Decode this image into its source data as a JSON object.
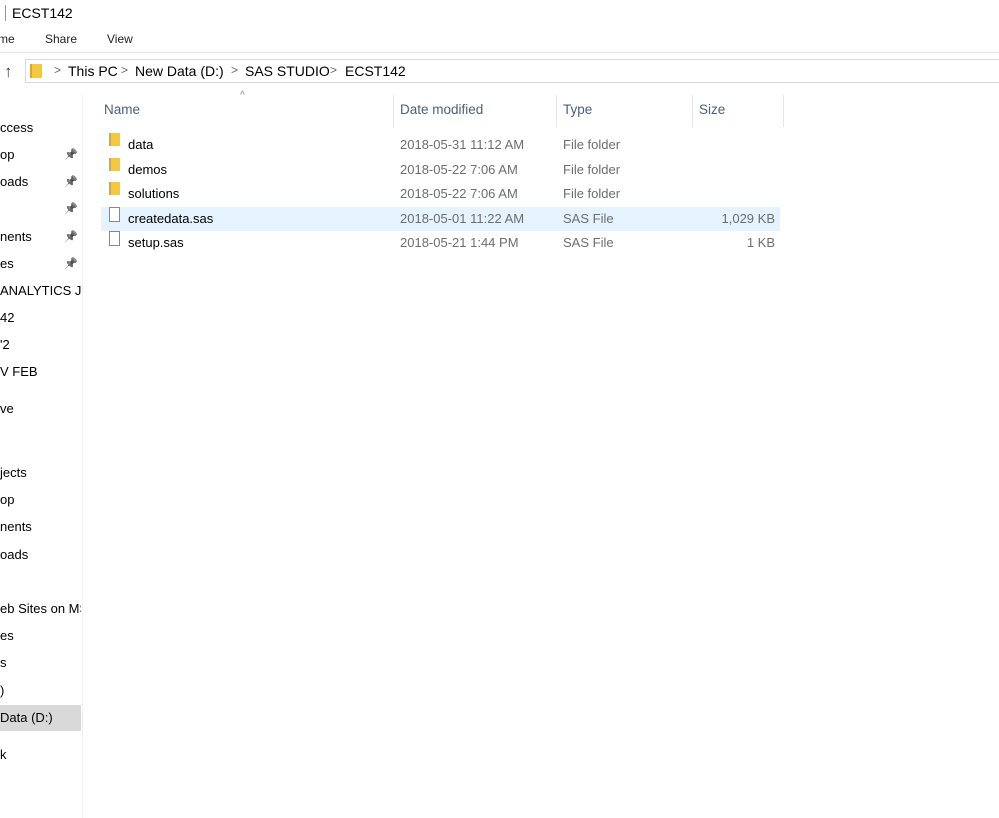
{
  "window": {
    "title": "ECST142"
  },
  "ribbon": {
    "tabs": [
      "me",
      "Share",
      "View"
    ]
  },
  "address": {
    "crumbs": [
      "This PC",
      "New Data (D:)",
      "SAS STUDIO",
      "ECST142"
    ]
  },
  "sidebar": {
    "items": [
      {
        "label": "ccess",
        "pinned": false
      },
      {
        "label": "op",
        "pinned": true
      },
      {
        "label": "oads",
        "pinned": true
      },
      {
        "label": "",
        "pinned": true
      },
      {
        "label": "nents",
        "pinned": true
      },
      {
        "label": "es",
        "pinned": true
      },
      {
        "label": "ANALYTICS JO",
        "pinned": false
      },
      {
        "label": "42",
        "pinned": false
      },
      {
        "label": "'2",
        "pinned": false
      },
      {
        "label": "V FEB",
        "pinned": false
      },
      {
        "label": "ve",
        "pinned": false
      },
      {
        "label": "jects",
        "pinned": false
      },
      {
        "label": "op",
        "pinned": false
      },
      {
        "label": "nents",
        "pinned": false
      },
      {
        "label": "oads",
        "pinned": false
      },
      {
        "label": "eb Sites on MS",
        "pinned": false
      },
      {
        "label": "es",
        "pinned": false
      },
      {
        "label": "s",
        "pinned": false
      },
      {
        "label": ")",
        "pinned": false
      },
      {
        "label": "Data (D:)",
        "pinned": false,
        "selected": true
      },
      {
        "label": "k",
        "pinned": false
      }
    ]
  },
  "columns": {
    "name": "Name",
    "date": "Date modified",
    "type": "Type",
    "size": "Size"
  },
  "files": [
    {
      "name": "data",
      "date": "2018-05-31 11:12 AM",
      "type": "File folder",
      "size": "",
      "icon": "folder"
    },
    {
      "name": "demos",
      "date": "2018-05-22 7:06 AM",
      "type": "File folder",
      "size": "",
      "icon": "folder"
    },
    {
      "name": "solutions",
      "date": "2018-05-22 7:06 AM",
      "type": "File folder",
      "size": "",
      "icon": "folder"
    },
    {
      "name": "createdata.sas",
      "date": "2018-05-01 11:22 AM",
      "type": "SAS File",
      "size": "1,029 KB",
      "icon": "file",
      "highlighted": true
    },
    {
      "name": "setup.sas",
      "date": "2018-05-21 1:44 PM",
      "type": "SAS File",
      "size": "1 KB",
      "icon": "file"
    }
  ]
}
